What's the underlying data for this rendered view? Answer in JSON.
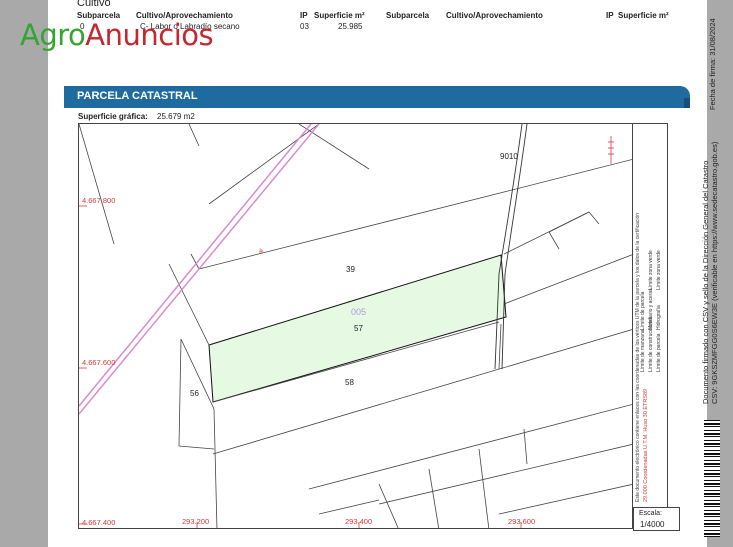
{
  "header": {
    "section_title": "Cultivo",
    "columns": [
      "Subparcela",
      "Cultivo/Aprovechamiento",
      "IP",
      "Superficie m²",
      "Subparcela",
      "Cultivo/Aprovechamiento",
      "IP",
      "Superficie m²"
    ],
    "row": {
      "subparcela": "0",
      "cultivo": "C- Labor o Labradío secano",
      "ip": "03",
      "superficie": "25.985"
    }
  },
  "logo": {
    "part1": "Agro",
    "part2": "Anuncios"
  },
  "banner": {
    "title": "PARCELA CATASTRAL"
  },
  "surface": {
    "label": "Superficie gráfica:",
    "value": "25.679 m2"
  },
  "map": {
    "coord_labels": [
      "4.667.800",
      "4.667.600",
      "4.667.400",
      "293.200",
      "293.400",
      "293.600"
    ],
    "parcel_labels": [
      "9010",
      "39",
      "005",
      "57",
      "58",
      "56"
    ],
    "road_label": "al"
  },
  "legend": {
    "col1": [
      "Límite de manzana",
      "Límite de parcela",
      "Límite de construcciones",
      "Mobiliario y aceras",
      "Límite zona verde"
    ],
    "col2": [
      "Límite de parcela",
      "Hidrografía",
      "Límite zona verde"
    ],
    "coords_note": "29.000 Coordenadas U.T.M. Huso 30 ETRS89",
    "note": "Este documento electrónico contiene enlaces con las coordenadas de los vértices UTM de la parcela y los datos de la certificación"
  },
  "scale": {
    "label": "Escala:",
    "value": "1/4000"
  },
  "side": {
    "line1": "Documento firmado con CSV y sello de la Dirección General del Catastro",
    "line2": "CSV: 9GKSZMFGG0S6EW3E (verificable en https://www.sedecatastro.gob.es)",
    "date": "Fecha de firma: 31/08/2024"
  },
  "colors": {
    "banner": "#1f6ba0",
    "parcel_fill": "#e6f9e3",
    "logo_green": "#36a433",
    "logo_red": "#c7262e",
    "coords": "#d9383a",
    "road": "#d98ad2"
  }
}
